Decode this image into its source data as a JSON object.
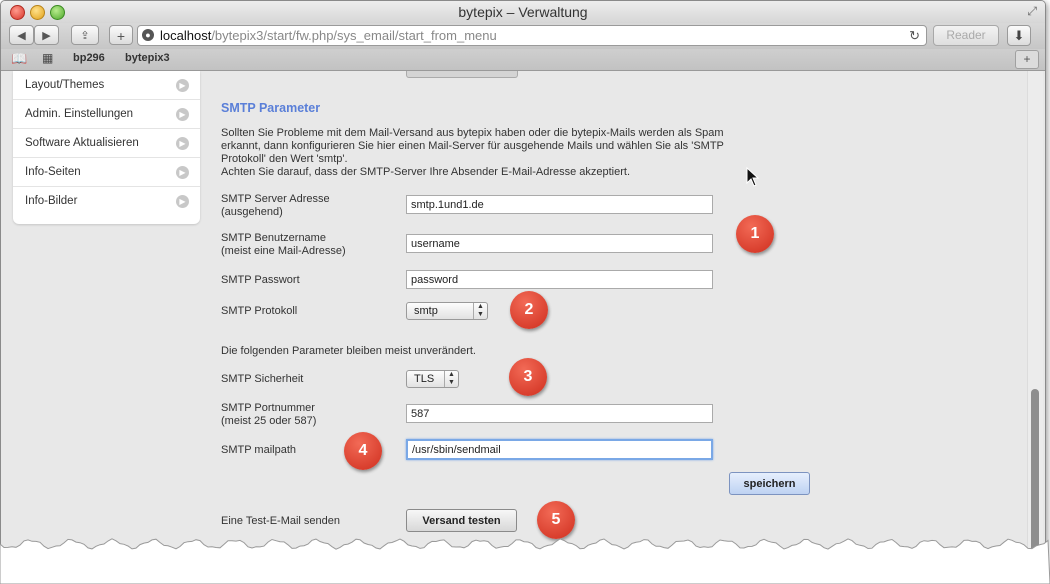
{
  "window": {
    "title": "bytepix – Verwaltung"
  },
  "toolbar": {
    "url_host": "localhost",
    "url_path": "/bytepix3/start/fw.php/sys_email/start_from_menu",
    "reader_label": "Reader",
    "icons": [
      "back-icon",
      "forward-icon",
      "share-icon",
      "add-tab-icon",
      "globe-icon",
      "reload-icon",
      "download-icon"
    ]
  },
  "bookmarks": {
    "items": [
      "bp296",
      "bytepix3"
    ]
  },
  "sidebar": {
    "items": [
      {
        "label": "Layout/Themes"
      },
      {
        "label": "Admin. Einstellungen"
      },
      {
        "label": "Software Aktualisieren"
      },
      {
        "label": "Info-Seiten"
      },
      {
        "label": "Info-Bilder"
      }
    ]
  },
  "smtp": {
    "title": "SMTP Parameter",
    "desc_line1": "Sollten Sie Probleme mit dem Mail-Versand aus bytepix haben oder die bytepix-Mails werden als Spam",
    "desc_line2": "erkannt, dann konfigurieren Sie hier einen Mail-Server für ausgehende Mails und wählen Sie als 'SMTP",
    "desc_line3": "Protokoll' den Wert 'smtp'.",
    "desc_line4": "Achten Sie darauf, dass der SMTP-Server Ihre Absender E-Mail-Adresse akzeptiert.",
    "server_label_1": "SMTP Server Adresse",
    "server_label_2": "(ausgehend)",
    "server_value": "smtp.1und1.de",
    "user_label_1": "SMTP Benutzername",
    "user_label_2": "(meist eine Mail-Adresse)",
    "user_value": "username",
    "password_label": "SMTP Passwort",
    "password_value": "password",
    "protocol_label": "SMTP Protokoll",
    "protocol_value": "smtp",
    "info_text": "Die folgenden Parameter bleiben meist unverändert.",
    "security_label": "SMTP Sicherheit",
    "security_value": "TLS",
    "port_label_1": "SMTP Portnummer",
    "port_label_2": "(meist 25 oder 587)",
    "port_value": "587",
    "mailpath_label": "SMTP mailpath",
    "mailpath_value": "/usr/sbin/sendmail",
    "save_label": "speichern",
    "test_label": "Eine Test-E-Mail senden",
    "test_button": "Versand testen"
  },
  "markers": [
    "1",
    "2",
    "3",
    "4",
    "5"
  ],
  "colors": {
    "section_title": "#5a7fd8",
    "marker": "#d83a28",
    "save_button": "#c8d9f5"
  }
}
